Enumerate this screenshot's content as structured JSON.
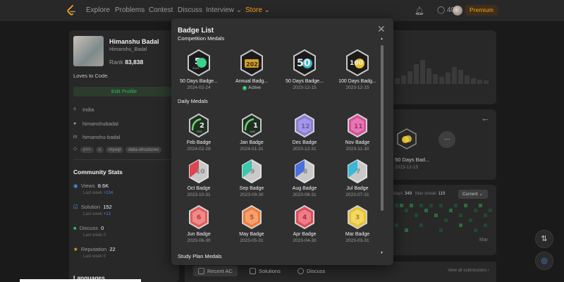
{
  "nav": {
    "links": [
      "Explore",
      "Problems",
      "Contest",
      "Discuss",
      "Interview ⌄",
      "Store ⌄"
    ],
    "coins": "402",
    "premium": "Premium"
  },
  "profile": {
    "name": "Himanshu Badal",
    "username": "Himanshu_Badal",
    "rank_label": "Rank",
    "rank": "83,838",
    "bio": "Loves to Code.",
    "edit": "Edit Profile",
    "location": "India",
    "github": "himanshubadal",
    "linkedin": "himanshu-badal",
    "tags": [
      "c++",
      "c",
      "mysql",
      "data-structures"
    ],
    "community_title": "Community Stats",
    "stats": [
      {
        "label": "Views",
        "value": "8.6K",
        "sub": "Last week",
        "delta": "+134"
      },
      {
        "label": "Solution",
        "value": "152",
        "sub": "Last week",
        "delta": "+13"
      },
      {
        "label": "Discuss",
        "value": "0",
        "sub": "Last week",
        "delta": "0"
      },
      {
        "label": "Reputation",
        "value": "22",
        "sub": "Last week",
        "delta": "0"
      }
    ],
    "languages_title": "Languages"
  },
  "background": {
    "badge_name": "50 Days Bad...",
    "badge_date": "2023-12-15",
    "streak_days_label": "days:",
    "streak_days": "349",
    "max_streak_label": "Max streak:",
    "max_streak": "119",
    "current": "Current ⌄",
    "month": "Mar",
    "tabs": [
      "Recent AC",
      "Solutions",
      "Discuss"
    ],
    "view_all": "View all submissions ›"
  },
  "modal": {
    "title": "Badge List",
    "sections": [
      "Competition Medals",
      "Daily Medals",
      "Study Plan Medals"
    ],
    "competition": [
      {
        "name": "50 Days Badge...",
        "date": "2024-02-24",
        "icon_text": "2024",
        "active": false
      },
      {
        "name": "Annual Badg...",
        "date": "Active",
        "icon_text": "2023",
        "active": true
      },
      {
        "name": "50 Days Badge...",
        "date": "2023-12-15",
        "icon_text": "50",
        "active": false
      },
      {
        "name": "100 Days Badg...",
        "date": "2023-12-15",
        "icon_text": "100",
        "active": false
      }
    ],
    "daily": [
      {
        "name": "Feb Badge",
        "date": "2024-02-29",
        "icon_text": "2",
        "sub": "FEB"
      },
      {
        "name": "Jan Badge",
        "date": "2024-01-31",
        "icon_text": "1",
        "sub": "JAN"
      },
      {
        "name": "Dec Badge",
        "date": "2023-12-31",
        "icon_text": "12",
        "sub": ""
      },
      {
        "name": "Nov Badge",
        "date": "2023-11-30",
        "icon_text": "11",
        "sub": ""
      },
      {
        "name": "Oct Badge",
        "date": "2023-10-31",
        "icon_text": "10",
        "sub": ""
      },
      {
        "name": "Sep Badge",
        "date": "2023-09-30",
        "icon_text": "9",
        "sub": ""
      },
      {
        "name": "Aug Badge",
        "date": "2023-08-31",
        "icon_text": "8",
        "sub": ""
      },
      {
        "name": "Jul Badge",
        "date": "2023-07-31",
        "icon_text": "7",
        "sub": ""
      },
      {
        "name": "Jun Badge",
        "date": "2023-06-30",
        "icon_text": "6",
        "sub": ""
      },
      {
        "name": "May Badge",
        "date": "2023-05-31",
        "icon_text": "5",
        "sub": ""
      },
      {
        "name": "Apr Badge",
        "date": "2023-04-30",
        "icon_text": "4",
        "sub": ""
      },
      {
        "name": "Mar Badge",
        "date": "2023-03-31",
        "icon_text": "3",
        "sub": ""
      }
    ]
  },
  "colors": {
    "accent": "#ffa116",
    "green": "#2cbb5d",
    "dec": "#8c7bd6",
    "nov": "#d6509a",
    "oct": "#e0454f",
    "sep": "#3cc7b0",
    "aug": "#4a6fe0",
    "jul": "#3bb8d8",
    "jun": "#e45a5a",
    "may": "#ef7b3b",
    "apr": "#e04a5a",
    "mar": "#e8c22e"
  }
}
